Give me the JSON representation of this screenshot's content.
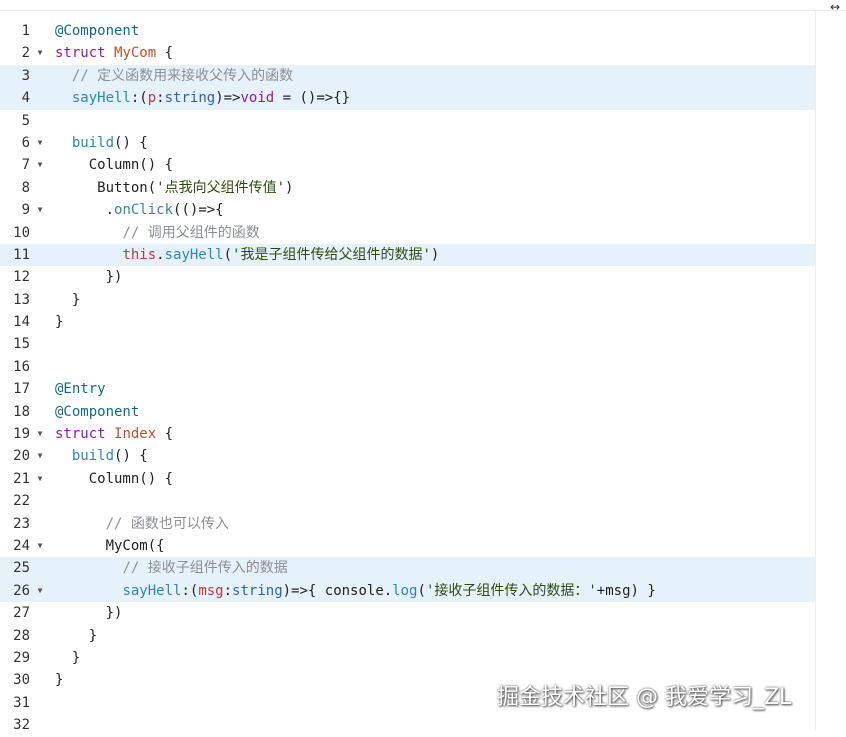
{
  "header": {
    "expand_icon": "↔"
  },
  "code": {
    "lines": [
      {
        "n": "1",
        "fold": "",
        "hl": false,
        "tokens": [
          {
            "c": "dec",
            "t": "@Component"
          }
        ]
      },
      {
        "n": "2",
        "fold": "▼",
        "hl": false,
        "tokens": [
          {
            "c": "kw",
            "t": "struct "
          },
          {
            "c": "cls",
            "t": "MyCom"
          },
          {
            "c": "plain",
            "t": " {"
          }
        ]
      },
      {
        "n": "3",
        "fold": "",
        "hl": true,
        "tokens": [
          {
            "c": "plain",
            "t": "  "
          },
          {
            "c": "com",
            "t": "// 定义函数用来接收父传入的函数"
          }
        ]
      },
      {
        "n": "4",
        "fold": "",
        "hl": true,
        "tokens": [
          {
            "c": "plain",
            "t": "  "
          },
          {
            "c": "fn",
            "t": "sayHell"
          },
          {
            "c": "plain",
            "t": ":("
          },
          {
            "c": "var",
            "t": "p"
          },
          {
            "c": "plain",
            "t": ":"
          },
          {
            "c": "type",
            "t": "string"
          },
          {
            "c": "plain",
            "t": ")=>"
          },
          {
            "c": "kw",
            "t": "void"
          },
          {
            "c": "plain",
            "t": " = ()=>{}"
          }
        ]
      },
      {
        "n": "5",
        "fold": "",
        "hl": false,
        "tokens": []
      },
      {
        "n": "6",
        "fold": "▼",
        "hl": false,
        "tokens": [
          {
            "c": "plain",
            "t": "  "
          },
          {
            "c": "fn",
            "t": "build"
          },
          {
            "c": "plain",
            "t": "() {"
          }
        ]
      },
      {
        "n": "7",
        "fold": "▼",
        "hl": false,
        "tokens": [
          {
            "c": "plain",
            "t": "    Column() {"
          }
        ]
      },
      {
        "n": "8",
        "fold": "",
        "hl": false,
        "tokens": [
          {
            "c": "plain",
            "t": "     Button("
          },
          {
            "c": "str",
            "t": "'点我向父组件传值'"
          },
          {
            "c": "plain",
            "t": ")"
          }
        ]
      },
      {
        "n": "9",
        "fold": "▼",
        "hl": false,
        "tokens": [
          {
            "c": "plain",
            "t": "      ."
          },
          {
            "c": "fn",
            "t": "onClick"
          },
          {
            "c": "plain",
            "t": "(()=>{"
          }
        ]
      },
      {
        "n": "10",
        "fold": "",
        "hl": false,
        "tokens": [
          {
            "c": "plain",
            "t": "        "
          },
          {
            "c": "com",
            "t": "// 调用父组件的函数"
          }
        ]
      },
      {
        "n": "11",
        "fold": "",
        "hl": true,
        "tokens": [
          {
            "c": "plain",
            "t": "        "
          },
          {
            "c": "var",
            "t": "this"
          },
          {
            "c": "plain",
            "t": "."
          },
          {
            "c": "fn",
            "t": "sayHell"
          },
          {
            "c": "plain",
            "t": "("
          },
          {
            "c": "str",
            "t": "'我是子组件传给父组件的数据'"
          },
          {
            "c": "plain",
            "t": ")"
          }
        ]
      },
      {
        "n": "12",
        "fold": "",
        "hl": false,
        "tokens": [
          {
            "c": "plain",
            "t": "      })"
          }
        ]
      },
      {
        "n": "13",
        "fold": "",
        "hl": false,
        "tokens": [
          {
            "c": "plain",
            "t": "  }"
          }
        ]
      },
      {
        "n": "14",
        "fold": "",
        "hl": false,
        "tokens": [
          {
            "c": "plain",
            "t": "}"
          }
        ]
      },
      {
        "n": "15",
        "fold": "",
        "hl": false,
        "tokens": []
      },
      {
        "n": "16",
        "fold": "",
        "hl": false,
        "tokens": []
      },
      {
        "n": "17",
        "fold": "",
        "hl": false,
        "tokens": [
          {
            "c": "dec",
            "t": "@Entry"
          }
        ]
      },
      {
        "n": "18",
        "fold": "",
        "hl": false,
        "tokens": [
          {
            "c": "dec",
            "t": "@Component"
          }
        ]
      },
      {
        "n": "19",
        "fold": "▼",
        "hl": false,
        "tokens": [
          {
            "c": "kw",
            "t": "struct "
          },
          {
            "c": "cls",
            "t": "Index"
          },
          {
            "c": "plain",
            "t": " {"
          }
        ]
      },
      {
        "n": "20",
        "fold": "▼",
        "hl": false,
        "tokens": [
          {
            "c": "plain",
            "t": "  "
          },
          {
            "c": "fn",
            "t": "build"
          },
          {
            "c": "plain",
            "t": "() {"
          }
        ]
      },
      {
        "n": "21",
        "fold": "▼",
        "hl": false,
        "tokens": [
          {
            "c": "plain",
            "t": "    Column() {"
          }
        ]
      },
      {
        "n": "22",
        "fold": "",
        "hl": false,
        "tokens": []
      },
      {
        "n": "23",
        "fold": "",
        "hl": false,
        "tokens": [
          {
            "c": "plain",
            "t": "      "
          },
          {
            "c": "com",
            "t": "// 函数也可以传入"
          }
        ]
      },
      {
        "n": "24",
        "fold": "▼",
        "hl": false,
        "tokens": [
          {
            "c": "plain",
            "t": "      MyCom({"
          }
        ]
      },
      {
        "n": "25",
        "fold": "",
        "hl": true,
        "tokens": [
          {
            "c": "plain",
            "t": "        "
          },
          {
            "c": "com",
            "t": "// 接收子组件传入的数据"
          }
        ]
      },
      {
        "n": "26",
        "fold": "▼",
        "hl": true,
        "tokens": [
          {
            "c": "plain",
            "t": "        "
          },
          {
            "c": "fn",
            "t": "sayHell"
          },
          {
            "c": "plain",
            "t": ":("
          },
          {
            "c": "var",
            "t": "msg"
          },
          {
            "c": "plain",
            "t": ":"
          },
          {
            "c": "type",
            "t": "string"
          },
          {
            "c": "plain",
            "t": ")=>{ console."
          },
          {
            "c": "fn",
            "t": "log"
          },
          {
            "c": "plain",
            "t": "("
          },
          {
            "c": "str",
            "t": "'接收子组件传入的数据：'"
          },
          {
            "c": "plain",
            "t": "+msg) }"
          }
        ]
      },
      {
        "n": "27",
        "fold": "",
        "hl": false,
        "tokens": [
          {
            "c": "plain",
            "t": "      })"
          }
        ]
      },
      {
        "n": "28",
        "fold": "",
        "hl": false,
        "tokens": [
          {
            "c": "plain",
            "t": "    }"
          }
        ]
      },
      {
        "n": "29",
        "fold": "",
        "hl": false,
        "tokens": [
          {
            "c": "plain",
            "t": "  }"
          }
        ]
      },
      {
        "n": "30",
        "fold": "",
        "hl": false,
        "tokens": [
          {
            "c": "plain",
            "t": "}"
          }
        ]
      },
      {
        "n": "31",
        "fold": "",
        "hl": false,
        "tokens": []
      },
      {
        "n": "32",
        "fold": "",
        "hl": false,
        "tokens": []
      }
    ]
  },
  "watermark": {
    "text": "掘金技术社区 @ 我爱学习_ZL"
  },
  "colors": {
    "highlight_bg": "#e5f1fb",
    "decorator": "#116b86",
    "keyword": "#8b1ab5",
    "class_name": "#c0502a",
    "type": "#2d5fb8",
    "comment": "#8a8f94",
    "string": "#2d4d0e",
    "function": "#2f87ad",
    "variable": "#c03a3a"
  }
}
